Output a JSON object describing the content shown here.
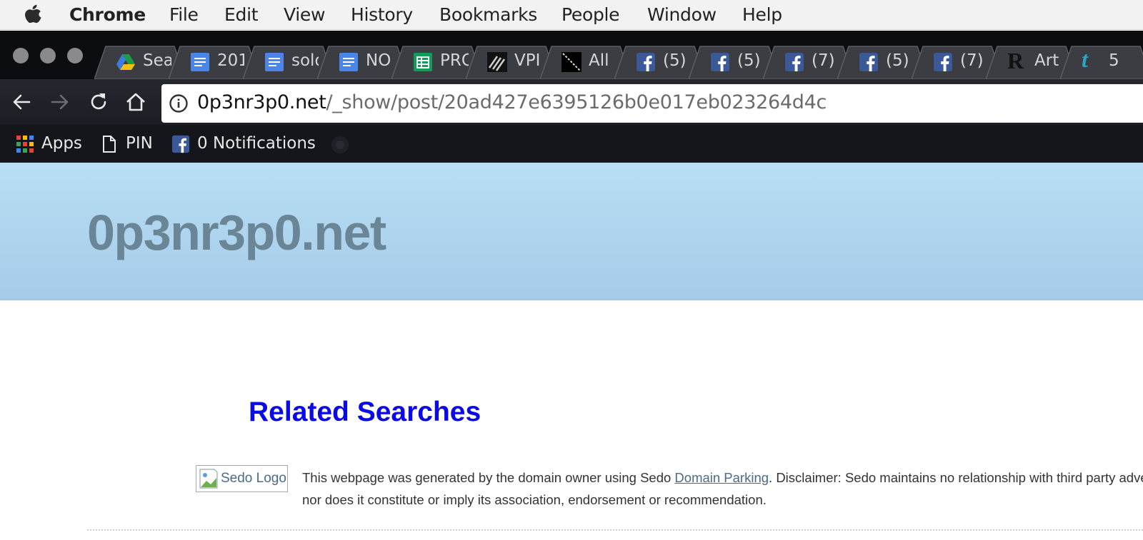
{
  "menubar": {
    "app_name": "Chrome",
    "items": [
      "File",
      "Edit",
      "View",
      "History",
      "Bookmarks",
      "People",
      "Window",
      "Help"
    ]
  },
  "tabs": [
    {
      "label": "Sea",
      "icon": "google-drive-icon"
    },
    {
      "label": "201",
      "icon": "google-docs-icon"
    },
    {
      "label": "sold",
      "icon": "google-docs-icon"
    },
    {
      "label": "NO",
      "icon": "google-docs-icon"
    },
    {
      "label": "PRO",
      "icon": "google-sheets-icon"
    },
    {
      "label": "VPI",
      "icon": "vpi-icon"
    },
    {
      "label": "All",
      "icon": "all-icon"
    },
    {
      "label": "(5)",
      "icon": "facebook-icon"
    },
    {
      "label": "(5)",
      "icon": "facebook-icon"
    },
    {
      "label": "(7)",
      "icon": "facebook-icon"
    },
    {
      "label": "(5)",
      "icon": "facebook-icon"
    },
    {
      "label": "(7)",
      "icon": "facebook-icon"
    },
    {
      "label": "Artı",
      "icon": "r-icon"
    },
    {
      "label": "5",
      "icon": "tumblr-icon"
    }
  ],
  "omnibox": {
    "host": "0p3nr3p0.net",
    "path": "/_show/post/20ad427e6395126b0e017eb023264d4c"
  },
  "bookmarks": [
    {
      "label": "Apps",
      "icon": "apps-grid-icon"
    },
    {
      "label": "PIN",
      "icon": "page-icon"
    },
    {
      "label": "0 Notifications",
      "icon": "facebook-icon"
    }
  ],
  "page": {
    "site_title": "0p3nr3p0.net",
    "related_heading": "Related Searches",
    "logo_alt": "Sedo Logo",
    "disclaimer_pre": "This webpage was generated by the domain owner using Sedo ",
    "disclaimer_link": "Domain Parking",
    "disclaimer_post": ". Disclaimer: Sedo maintains no relationship with third party advertisers.",
    "disclaimer_line2": "nor does it constitute or imply its association, endorsement or recommendation."
  },
  "colors": {
    "banner_top": "#b9def4",
    "banner_bottom": "#a5cbe8",
    "site_title": "#6a8596",
    "related_heading": "#0a0ae6",
    "chrome_dark": "#0f1117",
    "facebook_blue": "#3b5998"
  }
}
